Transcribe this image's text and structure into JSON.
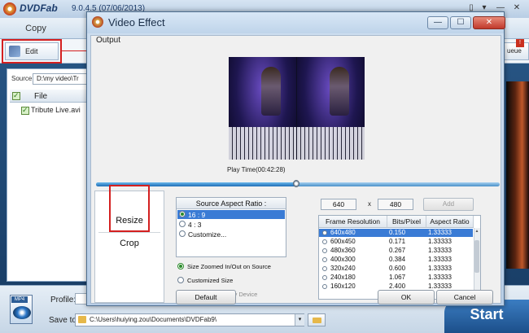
{
  "app": {
    "brand": "DVDFab",
    "version": "9.0.4.5 (07/06/2013)",
    "controls": [
      "▯",
      "▾",
      "—",
      "✕"
    ],
    "tab_copy": "Copy",
    "edit_label": "Edit",
    "queue_label": "ueue",
    "queue_badge": "!",
    "source_label": "Source:",
    "source_value": "D:\\my video\\Tr",
    "file_header": "File",
    "file_name": "Tribute Live.avi",
    "profile_label": "Profile:",
    "saveto_label": "Save to:",
    "saveto_value": "C:\\Users\\huiying.zou\\Documents\\DVDFab9\\",
    "dropdown_glyph": "▾",
    "start_label": "Start",
    "mp4_tag": "MP4"
  },
  "dialog": {
    "title": "Video Effect",
    "minimize": "—",
    "maximize": "☐",
    "close": "✕",
    "output_label": "Output",
    "play_time": "Play Time(00:42:28)",
    "progress_fraction": 0.5,
    "nav": [
      "Resize",
      "Crop"
    ],
    "aspect_header": "Source Aspect Ratio :",
    "aspect_options": [
      "16 : 9",
      "4 : 3",
      "Customize..."
    ],
    "aspect_selected": 0,
    "zoom_options": [
      "Size Zoomed In/Out on Source",
      "Customized Size",
      "Size Supported by Device"
    ],
    "width": "640",
    "x_sep": "x",
    "height": "480",
    "add_label": "Add",
    "table_headers": [
      "Frame Resolution",
      "Bits/Pixel",
      "Aspect Ratio"
    ],
    "table_rows": [
      [
        "640x480",
        "0.150",
        "1.33333"
      ],
      [
        "600x450",
        "0.171",
        "1.33333"
      ],
      [
        "480x360",
        "0.267",
        "1.33333"
      ],
      [
        "400x300",
        "0.384",
        "1.33333"
      ],
      [
        "320x240",
        "0.600",
        "1.33333"
      ],
      [
        "240x180",
        "1.067",
        "1.33333"
      ],
      [
        "160x120",
        "2.400",
        "1.33333"
      ]
    ],
    "default_label": "Default",
    "ok_label": "OK",
    "cancel_label": "Cancel"
  },
  "colors": {
    "selection": "#3a7bd5",
    "callout": "#d42020",
    "start_button": "#1c4f8a"
  }
}
